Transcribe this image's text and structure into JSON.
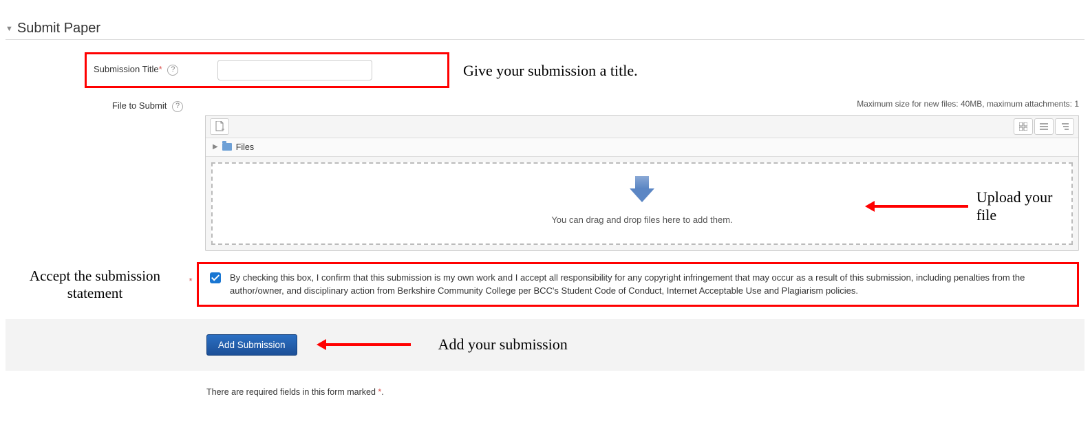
{
  "header": {
    "title": "Submit Paper"
  },
  "titleField": {
    "label": "Submission Title",
    "value": "",
    "placeholder": ""
  },
  "fileField": {
    "label": "File to Submit",
    "sizeHint": "Maximum size for new files: 40MB, maximum attachments: 1",
    "treeLabel": "Files",
    "dropText": "You can drag and drop files here to add them."
  },
  "acceptField": {
    "checked": true,
    "text": "By checking this box, I confirm that this submission is my own work and I accept all responsibility for any copyright infringement that may occur as a result of this submission, including penalties from the author/owner, and disciplinary action from Berkshire Community College per BCC's Student Code of Conduct, Internet Acceptable Use and Plagiarism policies."
  },
  "submit": {
    "buttonLabel": "Add Submission"
  },
  "notes": {
    "requiredPrefix": "There are required fields in this form marked ",
    "requiredMark": "*",
    "requiredSuffix": "."
  },
  "annotations": {
    "titleNote": "Give your submission a title.",
    "uploadNote": "Upload your file",
    "acceptNote1": "Accept the submission",
    "acceptNote2": "statement",
    "addNote": "Add your submission"
  }
}
